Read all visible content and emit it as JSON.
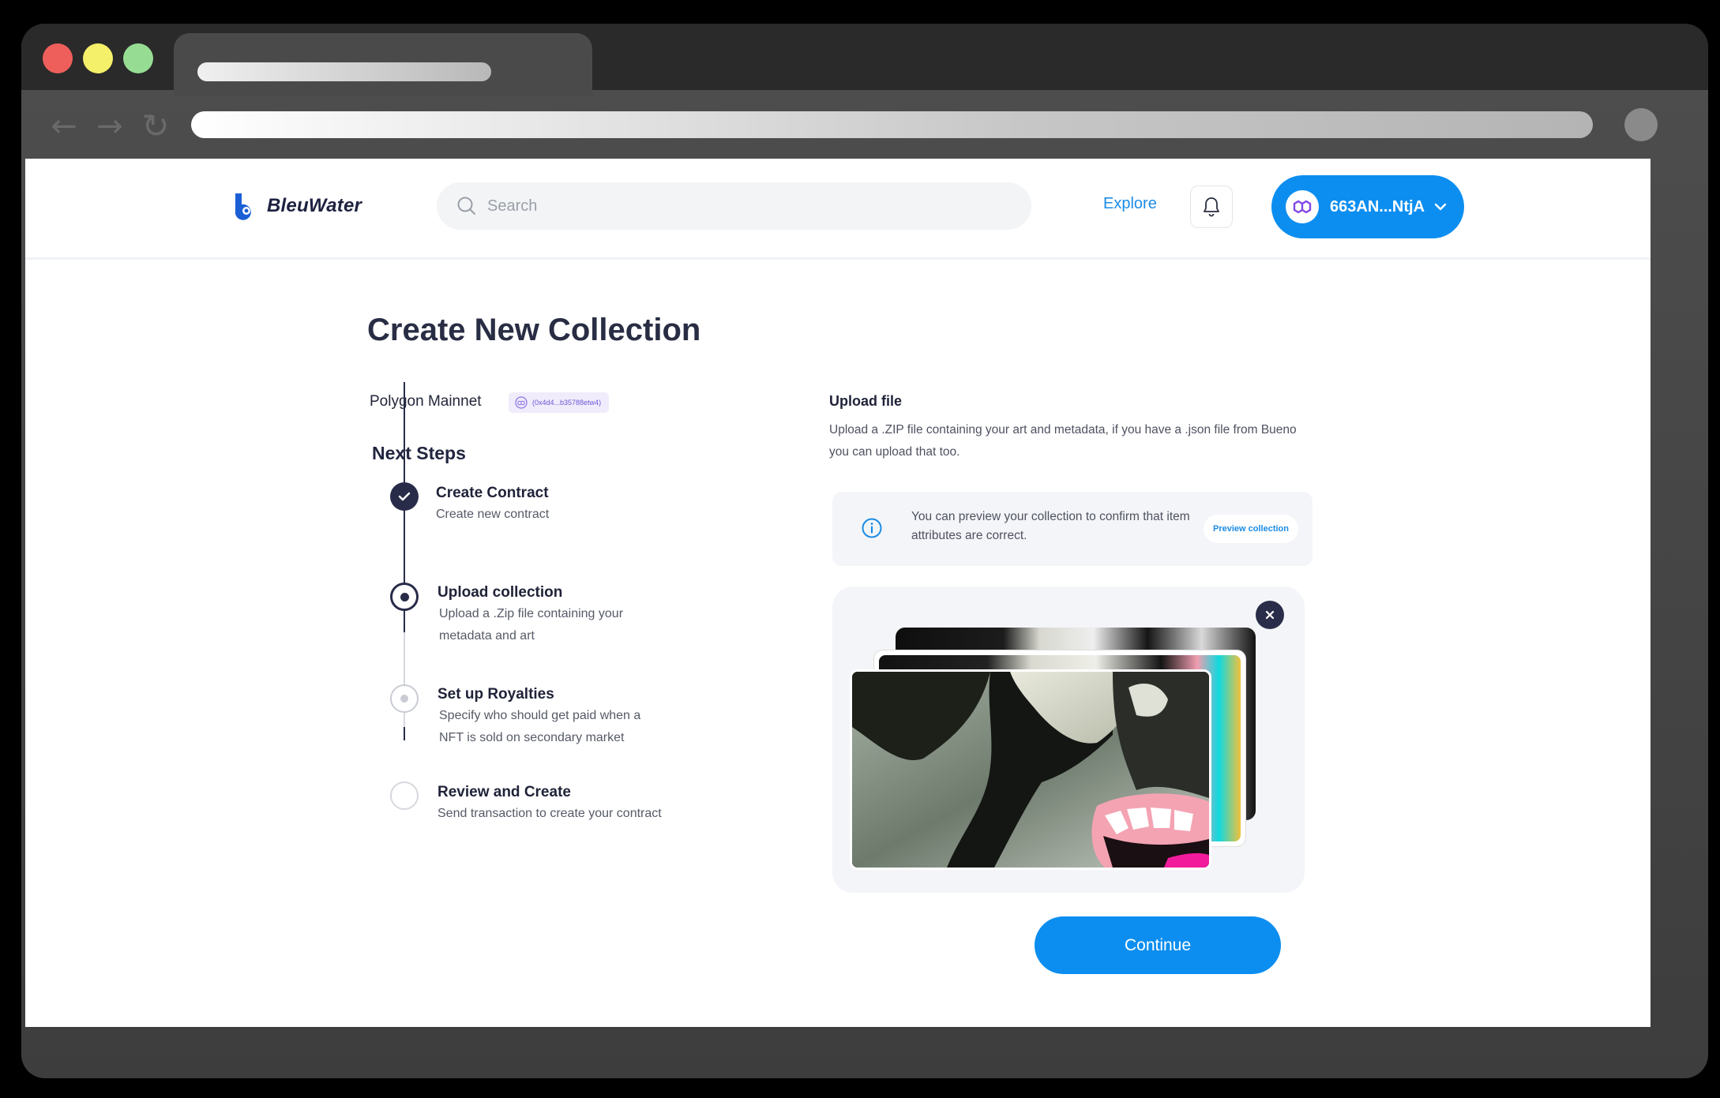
{
  "colors": {
    "accent": "#0c8ef0",
    "dark": "#282c49",
    "traffic_red": "#ee5f5b",
    "traffic_yellow": "#f5f06a",
    "traffic_green": "#96dd93"
  },
  "header": {
    "logo_text": "BleuWater",
    "search_placeholder": "Search",
    "explore_label": "Explore",
    "wallet_label": "663AN...NtjA"
  },
  "main": {
    "title": "Create New Collection",
    "network_name": "Polygon Mainnet",
    "network_address": "(0x4d4...b35788etw4)",
    "next_steps_heading": "Next Steps",
    "steps": [
      {
        "title": "Create Contract",
        "desc_1": "Create new contract",
        "desc_2": "",
        "status": "done"
      },
      {
        "title": "Upload collection",
        "desc_1": "Upload a .Zip file containing your",
        "desc_2": "metadata and art",
        "status": "current"
      },
      {
        "title": "Set up Royalties",
        "desc_1": "Specify who should get paid when a",
        "desc_2": "NFT is sold on secondary market",
        "status": "next"
      },
      {
        "title": "Review and Create",
        "desc_1": "Send transaction to create your contract",
        "desc_2": "",
        "status": "future"
      }
    ]
  },
  "upload": {
    "title": "Upload file",
    "description": "Upload a .ZIP file containing your art and metadata, if you have a .json file from Bueno you can upload that too.",
    "info_text": "You can preview your collection to confirm that item attributes are correct.",
    "preview_button": "Preview collection",
    "continue_button": "Continue"
  }
}
